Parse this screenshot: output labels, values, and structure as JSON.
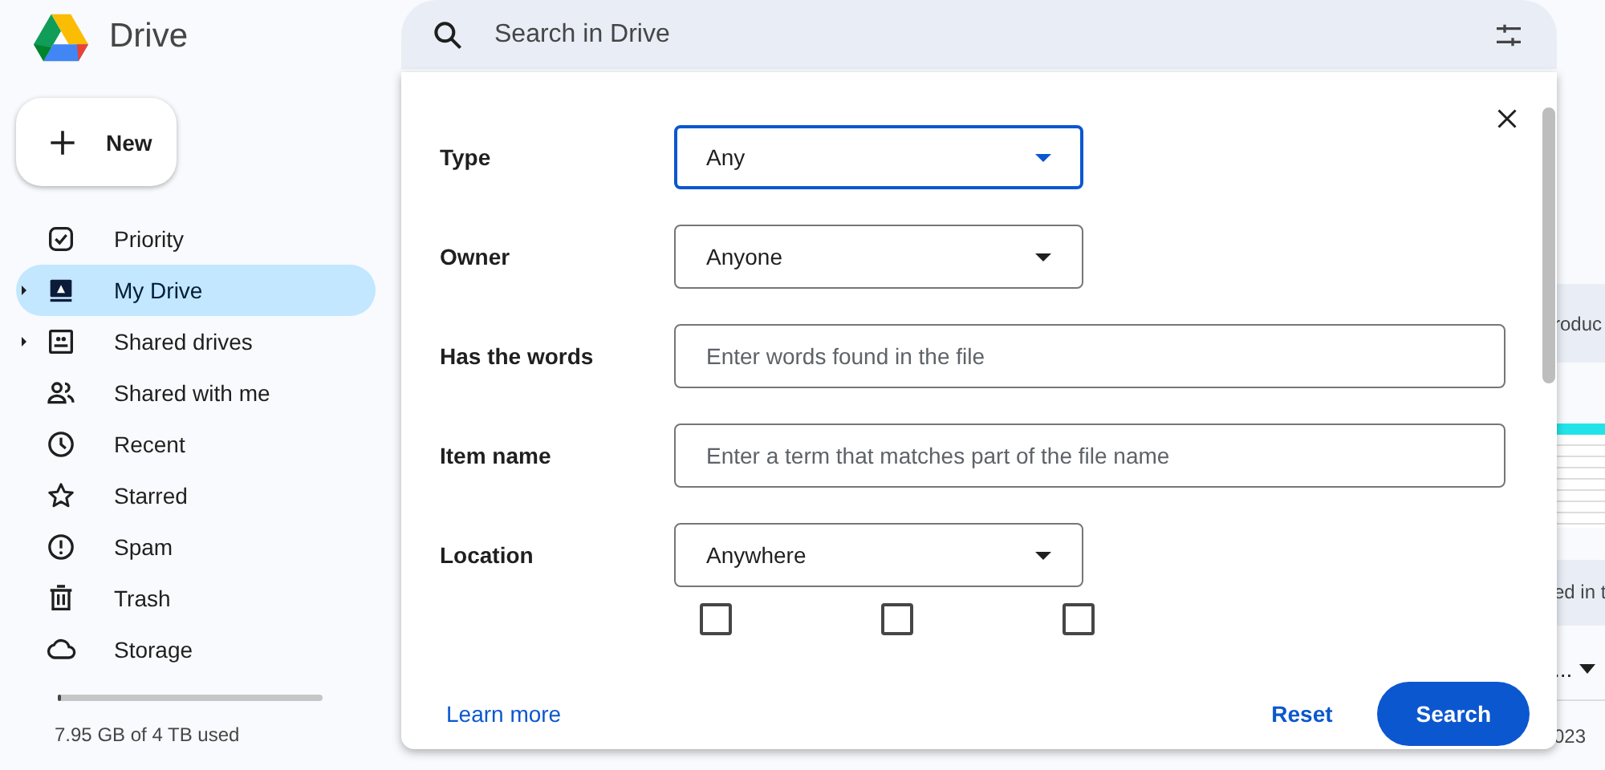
{
  "app": {
    "name": "Drive"
  },
  "new_button": {
    "label": "New"
  },
  "sidebar": {
    "items": [
      {
        "label": "Priority",
        "selected": false,
        "expandable": false
      },
      {
        "label": "My Drive",
        "selected": true,
        "expandable": true
      },
      {
        "label": "Shared drives",
        "selected": false,
        "expandable": true
      },
      {
        "label": "Shared with me",
        "selected": false,
        "expandable": false
      },
      {
        "label": "Recent",
        "selected": false,
        "expandable": false
      },
      {
        "label": "Starred",
        "selected": false,
        "expandable": false
      },
      {
        "label": "Spam",
        "selected": false,
        "expandable": false
      },
      {
        "label": "Trash",
        "selected": false,
        "expandable": false
      },
      {
        "label": "Storage",
        "selected": false,
        "expandable": false
      }
    ]
  },
  "storage": {
    "text": "7.95 GB of 4 TB used",
    "level": 0.01
  },
  "search": {
    "placeholder": "Search in Drive"
  },
  "dialog": {
    "fields": [
      {
        "label": "Type",
        "kind": "dropdown",
        "value": "Any",
        "focused": true
      },
      {
        "label": "Owner",
        "kind": "dropdown",
        "value": "Anyone",
        "focused": false
      },
      {
        "label": "Has the words",
        "kind": "text",
        "placeholder": "Enter words found in the file"
      },
      {
        "label": "Item name",
        "kind": "text",
        "placeholder": "Enter a term that matches part of the file name"
      },
      {
        "label": "Location",
        "kind": "dropdown",
        "value": "Anywhere",
        "focused": false
      }
    ],
    "checkboxes": [
      {
        "checked": false
      },
      {
        "checked": false
      },
      {
        "checked": false
      }
    ],
    "learn_more": "Learn more",
    "buttons": [
      {
        "label": "Reset",
        "kind": "text"
      },
      {
        "label": "Search",
        "kind": "filled"
      }
    ]
  },
  "background": {
    "texts": [
      "roduc",
      "ed in t",
      "...",
      "023"
    ]
  }
}
